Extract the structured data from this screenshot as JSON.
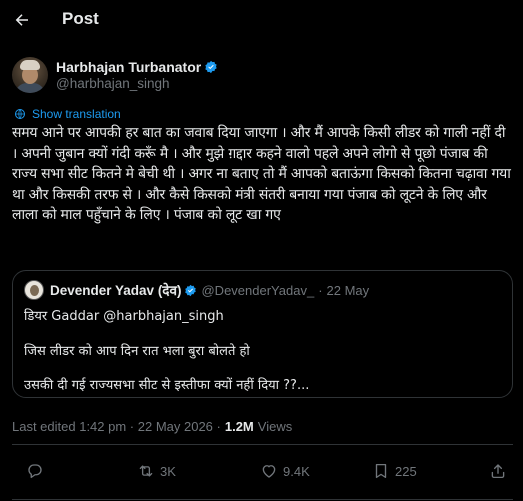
{
  "header": {
    "title": "Post"
  },
  "post": {
    "author_name": "Harbhajan Turbanator",
    "author_handle": "@harbhajan_singh",
    "show_translation": "Show translation",
    "text": "समय आने पर आपकी हर बात का जवाब दिया जाएगा । और मैं आपके किसी लीडर को गाली नहीं दी । अपनी जुबान क्यों गंदी करूँ मै । और मुझे ग़द्दार कहने वालो पहले अपने लोगो से पूछो पंजाब की राज्य सभा सीट कितने मे बेची थी । अगर ना बताए तो मैं आपको बताऊंगा किसको कितना चढ़ावा गया था और किसकी तरफ से । और कैसे किसको मंत्री संतरी बनाया गया पंजाब को लूटने के लिए और लाला को माल पहुँचाने के लिए । पंजाब को लूट खा गए",
    "last_edited": "Last edited 1:42 pm · 22 May 2026 ·",
    "views_count": "1.2M",
    "views_label": "Views"
  },
  "quoted": {
    "author_name": "Devender Yadav (देव)",
    "author_handle": "@DevenderYadav_",
    "separator": "·",
    "date": "22 May",
    "line1": "डियर Gaddar @harbhajan_singh",
    "line2": "जिस लीडर को आप दिन रात भला बुरा बोलते हो",
    "line3": "उसकी दी गई राज्यसभा सीट से इस्तीफा क्यों नहीं दिया ??..."
  },
  "actions": {
    "reposts": "3K",
    "likes": "9.4K",
    "bookmarks": "225"
  },
  "colors": {
    "background": "#000000",
    "text": "#e7e9ea",
    "muted": "#71767b",
    "accent": "#1d9bf0",
    "border": "#2f3336"
  },
  "icons": {
    "back": "arrow-left-icon",
    "verified": "verified-badge-icon",
    "translate": "translate-icon",
    "reply": "reply-icon",
    "repost": "repost-icon",
    "like": "heart-icon",
    "bookmark": "bookmark-icon",
    "share": "share-icon"
  }
}
